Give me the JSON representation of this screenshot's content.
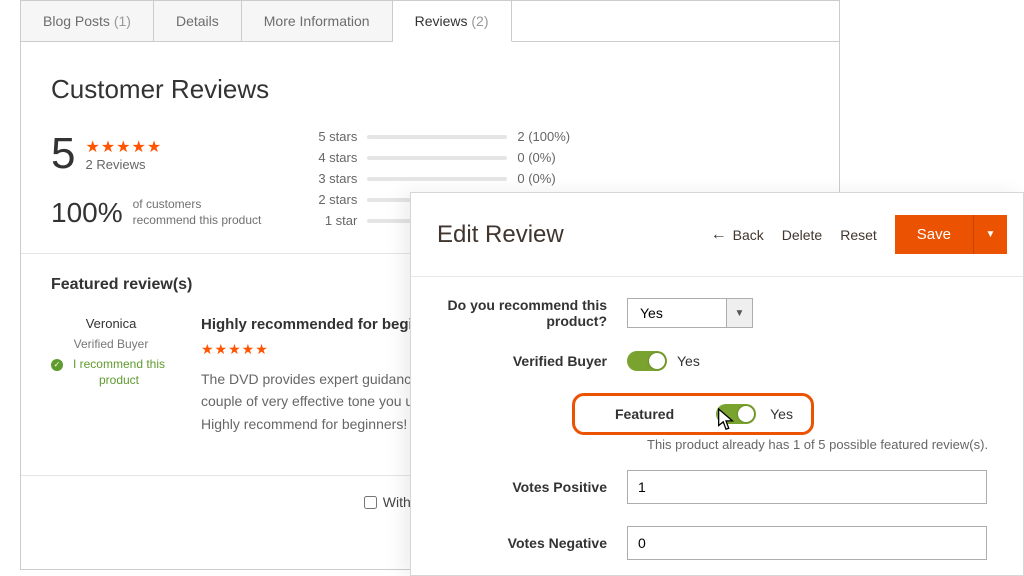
{
  "tabs": [
    {
      "label": "Blog Posts",
      "count": "(1)"
    },
    {
      "label": "Details",
      "count": ""
    },
    {
      "label": "More Information",
      "count": ""
    },
    {
      "label": "Reviews",
      "count": "(2)",
      "active": true
    }
  ],
  "section_title": "Customer Reviews",
  "summary": {
    "avg": "5",
    "avg_count": "2 Reviews",
    "recommend_pct": "100%",
    "recommend_text_1": "of customers",
    "recommend_text_2": "recommend this product"
  },
  "breakdown": [
    {
      "label": "5 stars",
      "pct": 100,
      "count": "2 (100%)"
    },
    {
      "label": "4 stars",
      "pct": 0,
      "count": "0 (0%)"
    },
    {
      "label": "3 stars",
      "pct": 0,
      "count": "0 (0%)"
    },
    {
      "label": "2 stars",
      "pct": 0,
      "count": ""
    },
    {
      "label": "1 star",
      "pct": 0,
      "count": ""
    }
  ],
  "featured_heading": "Featured review(s)",
  "featured_review": {
    "author": "Veronica",
    "verified": "Verified Buyer",
    "rec_badge": "I recommend this product",
    "title": "Highly recommended for beginners!",
    "body": "The DVD provides expert guidance for the find, followed by a couple of very effective tone you up and calm you down.\nHighly recommend for beginners!"
  },
  "filters": {
    "with_pictures": "With Pictures"
  },
  "admin": {
    "title": "Edit Review",
    "back": "Back",
    "delete": "Delete",
    "reset": "Reset",
    "save": "Save",
    "fields": {
      "recommend_label": "Do you recommend this product?",
      "recommend_value": "Yes",
      "verified_label": "Verified Buyer",
      "verified_value": "Yes",
      "featured_label": "Featured",
      "featured_value": "Yes",
      "featured_note": "This product already has 1 of 5 possible featured review(s).",
      "votes_pos_label": "Votes Positive",
      "votes_pos_value": "1",
      "votes_neg_label": "Votes Negative",
      "votes_neg_value": "0"
    }
  }
}
